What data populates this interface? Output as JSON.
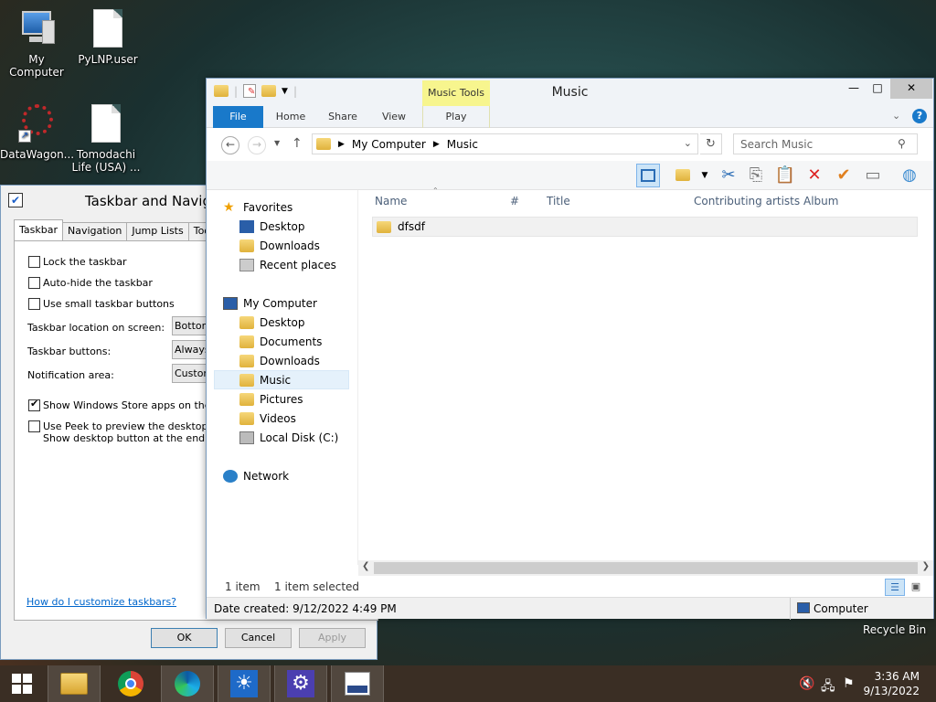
{
  "desktop": {
    "icons": [
      {
        "label": "My Computer"
      },
      {
        "label": "PyLNP.user"
      },
      {
        "label": "DataWagon..."
      },
      {
        "label": "Tomodachi Life (USA) ..."
      }
    ],
    "recycle_label": "Recycle Bin"
  },
  "taskbar_dialog": {
    "title": "Taskbar and Navigation properties",
    "tabs": [
      "Taskbar",
      "Navigation",
      "Jump Lists",
      "Toolbars"
    ],
    "checkboxes": [
      {
        "label": "Lock the taskbar",
        "checked": false
      },
      {
        "label": "Auto-hide the taskbar",
        "checked": false
      },
      {
        "label": "Use small taskbar buttons",
        "checked": false
      }
    ],
    "location_label": "Taskbar location on screen:",
    "location_value": "Bottom",
    "buttons_label": "Taskbar buttons:",
    "buttons_value": "Always",
    "notification_label": "Notification area:",
    "notification_value": "Customize",
    "store_apps_label": "Show Windows Store apps on the taskbar",
    "peek_label_line1": "Use Peek to preview the desktop when",
    "peek_label_line2": "Show desktop button at the end of the",
    "help_link": "How do I customize taskbars?",
    "ok": "OK",
    "cancel": "Cancel",
    "apply": "Apply"
  },
  "explorer": {
    "title": "Music",
    "context_tab": "Music Tools",
    "ribbon_tabs": [
      "File",
      "Home",
      "Share",
      "View",
      "Play"
    ],
    "address": [
      "My Computer",
      "Music"
    ],
    "search_placeholder": "Search Music",
    "nav": {
      "favorites": "Favorites",
      "fav_items": [
        "Desktop",
        "Downloads",
        "Recent places"
      ],
      "computer": "My Computer",
      "computer_items": [
        "Desktop",
        "Documents",
        "Downloads",
        "Music",
        "Pictures",
        "Videos",
        "Local Disk (C:)"
      ],
      "network": "Network"
    },
    "columns": [
      "Name",
      "#",
      "Title",
      "Contributing artists",
      "Album"
    ],
    "files": [
      {
        "name": "dfsdf"
      }
    ],
    "status_count": "1 item",
    "status_selected": "1 item selected",
    "details_date": "Date created: 9/12/2022 4:49 PM",
    "details_location": "Computer"
  },
  "clock": {
    "time": "3:36 AM",
    "date": "9/13/2022"
  },
  "colors": {
    "accent": "#1979ca",
    "context_tab": "#f7f58e",
    "taskbar": "#3a2e24"
  }
}
